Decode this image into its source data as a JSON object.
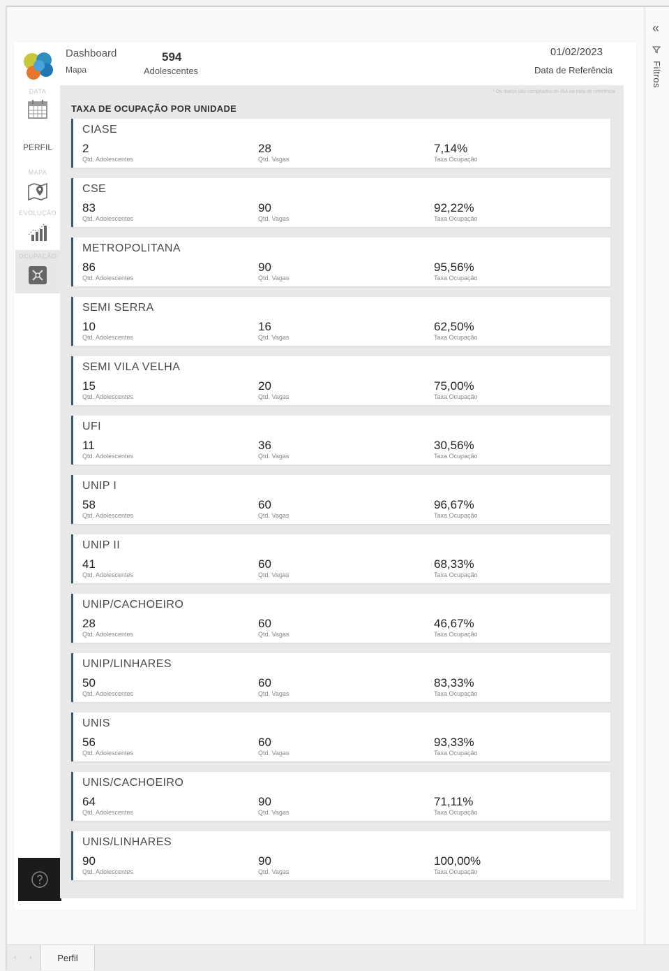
{
  "header": {
    "dashboard_label": "Dashboard",
    "mapa_link": "Mapa",
    "total_count": "594",
    "total_label": "Adolescentes",
    "reference_date": "01/02/2023",
    "reference_date_label": "Data de Referência"
  },
  "nav": {
    "data_label": "DATA",
    "perfil_label": "PERFIL",
    "mapa_label": "MAPA",
    "evolucao_label": "EVOLUÇÃO",
    "ocupacao_label": "OCUPAÇÃO"
  },
  "filters": {
    "label": "Filtros"
  },
  "panel": {
    "title": "TAXA DE OCUPAÇÃO POR UNIDADE",
    "note": "* Os dados são compilados do IBA na data de referência",
    "label_adolescentes": "Qtd. Adolescentes",
    "label_vagas": "Qtd. Vagas",
    "label_taxa": "Taxa Ocupação"
  },
  "units": [
    {
      "name": "CIASE",
      "adolescentes": "2",
      "vagas": "28",
      "taxa": "7,14%"
    },
    {
      "name": "CSE",
      "adolescentes": "83",
      "vagas": "90",
      "taxa": "92,22%"
    },
    {
      "name": "METROPOLITANA",
      "adolescentes": "86",
      "vagas": "90",
      "taxa": "95,56%"
    },
    {
      "name": "SEMI SERRA",
      "adolescentes": "10",
      "vagas": "16",
      "taxa": "62,50%"
    },
    {
      "name": "SEMI VILA VELHA",
      "adolescentes": "15",
      "vagas": "20",
      "taxa": "75,00%"
    },
    {
      "name": "UFI",
      "adolescentes": "11",
      "vagas": "36",
      "taxa": "30,56%"
    },
    {
      "name": "UNIP I",
      "adolescentes": "58",
      "vagas": "60",
      "taxa": "96,67%"
    },
    {
      "name": "UNIP II",
      "adolescentes": "41",
      "vagas": "60",
      "taxa": "68,33%"
    },
    {
      "name": "UNIP/CACHOEIRO",
      "adolescentes": "28",
      "vagas": "60",
      "taxa": "46,67%"
    },
    {
      "name": "UNIP/LINHARES",
      "adolescentes": "50",
      "vagas": "60",
      "taxa": "83,33%"
    },
    {
      "name": "UNIS",
      "adolescentes": "56",
      "vagas": "60",
      "taxa": "93,33%"
    },
    {
      "name": "UNIS/CACHOEIRO",
      "adolescentes": "64",
      "vagas": "90",
      "taxa": "71,11%"
    },
    {
      "name": "UNIS/LINHARES",
      "adolescentes": "90",
      "vagas": "90",
      "taxa": "100,00%"
    }
  ],
  "tabs": {
    "page_tab": "Perfil"
  },
  "colors": {
    "accent": "#3a5b6e",
    "help_bg": "#1b1b1b"
  }
}
